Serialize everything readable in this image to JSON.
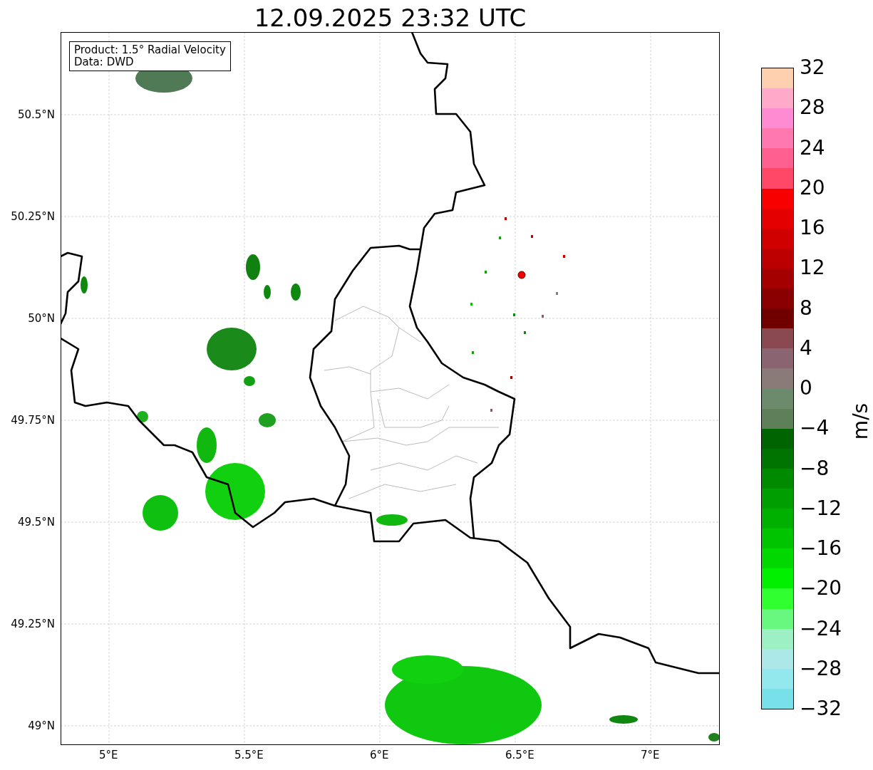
{
  "title": "12.09.2025 23:32 UTC",
  "info_box": {
    "lines": [
      "Product: 1.5° Radial Velocity",
      "Data: DWD"
    ]
  },
  "x_ticks": [
    "5°E",
    "5.5°E",
    "6°E",
    "6.5°E",
    "7°E"
  ],
  "y_ticks": [
    "50.5°N",
    "50.25°N",
    "50°N",
    "49.75°N",
    "49.5°N",
    "49.25°N",
    "49°N"
  ],
  "colorbar": {
    "label": "m/s",
    "ticks": [
      "32",
      "28",
      "24",
      "20",
      "16",
      "12",
      "8",
      "4",
      "0",
      "−4",
      "−8",
      "−12",
      "−16",
      "−20",
      "−24",
      "−28",
      "−32"
    ],
    "segments": [
      {
        "color": "#ffd0b0"
      },
      {
        "color": "#ffaac8"
      },
      {
        "color": "#ff8cd2"
      },
      {
        "color": "#ff78b0"
      },
      {
        "color": "#ff6090"
      },
      {
        "color": "#ff4868"
      },
      {
        "color": "#f80000"
      },
      {
        "color": "#e40000"
      },
      {
        "color": "#d00000"
      },
      {
        "color": "#bc0000"
      },
      {
        "color": "#a40000"
      },
      {
        "color": "#8a0000"
      },
      {
        "color": "#700000"
      },
      {
        "color": "#8a4850"
      },
      {
        "color": "#8a6470"
      },
      {
        "color": "#8a7a78"
      },
      {
        "color": "#6c8a6c"
      },
      {
        "color": "#5e8058"
      },
      {
        "color": "#006400"
      },
      {
        "color": "#007400"
      },
      {
        "color": "#008a00"
      },
      {
        "color": "#009e00"
      },
      {
        "color": "#00b000"
      },
      {
        "color": "#00c400"
      },
      {
        "color": "#00d800"
      },
      {
        "color": "#00f000"
      },
      {
        "color": "#30ff30"
      },
      {
        "color": "#68f880"
      },
      {
        "color": "#9cf0c4"
      },
      {
        "color": "#ace8e8"
      },
      {
        "color": "#92e8ec"
      },
      {
        "color": "#78e0e8"
      }
    ]
  }
}
